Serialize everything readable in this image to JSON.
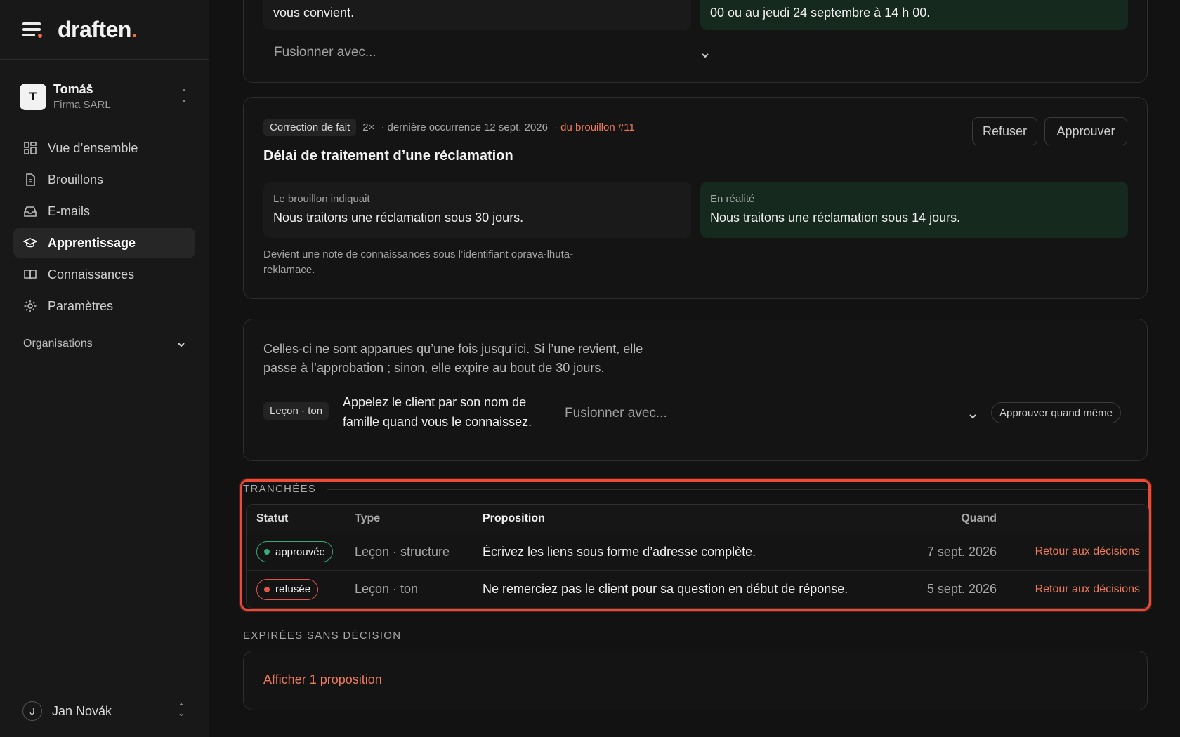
{
  "app": {
    "logo_text": "draften",
    "logo_dot": "."
  },
  "account": {
    "initial": "T",
    "name": "Tomáš",
    "company": "Firma SARL"
  },
  "nav": [
    {
      "label": "Vue d’ensemble",
      "icon": "grid-icon",
      "active": false
    },
    {
      "label": "Brouillons",
      "icon": "document-icon",
      "active": false
    },
    {
      "label": "E-mails",
      "icon": "inbox-icon",
      "active": false
    },
    {
      "label": "Apprentissage",
      "icon": "graduation-cap-icon",
      "active": true
    },
    {
      "label": "Connaissances",
      "icon": "book-icon",
      "active": false
    },
    {
      "label": "Paramètres",
      "icon": "gear-icon",
      "active": false
    }
  ],
  "organisations_label": "Organisations",
  "user": {
    "initial": "J",
    "name": "Jan Novák"
  },
  "card_top": {
    "left_text": "vous convient.",
    "right_text": "00 ou au jeudi 24 septembre à 14 h 00.",
    "merge_placeholder": "Fusionner avec..."
  },
  "card_fact": {
    "tag": "Correction de fait",
    "count": "2×",
    "last_seen": "· dernière occurrence 12 sept. 2026",
    "source": "· du brouillon #11",
    "refuse_label": "Refuser",
    "approve_label": "Approuver",
    "title": "Délai de traitement d’une réclamation",
    "left_label": "Le brouillon indiquait",
    "left_text": "Nous traitons une réclamation sous 30 jours.",
    "right_label": "En réalité",
    "right_text": "Nous traitons une réclamation sous 14 jours.",
    "note": "Devient une note de connaissances sous l’identifiant oprava-lhuta-reklamace."
  },
  "card_once": {
    "intro": "Celles-ci ne sont apparues qu’une fois jusqu’ici. Si l’une revient, elle passe à l’approbation ; sinon, elle expire au bout de 30 jours.",
    "tag": "Leçon · ton",
    "text": "Appelez le client par son nom de famille quand vous le connaissez.",
    "merge_placeholder": "Fusionner avec...",
    "approve_anyway": "Approuver quand même"
  },
  "decided": {
    "section": "TRANCHÉES",
    "headers": {
      "status": "Statut",
      "type": "Type",
      "proposal": "Proposition",
      "when": "Quand"
    },
    "rows": [
      {
        "status": "approuvée",
        "type": "Leçon · structure",
        "proposal": "Écrivez les liens sous forme d’adresse complète.",
        "when": "7 sept. 2026",
        "action": "Retour aux décisions"
      },
      {
        "status": "refusée",
        "type": "Leçon · ton",
        "proposal": "Ne remerciez pas le client pour sa question en début de réponse.",
        "when": "5 sept. 2026",
        "action": "Retour aux décisions"
      }
    ]
  },
  "expired": {
    "section": "EXPIRÉES SANS DÉCISION",
    "show_label": "Afficher 1 proposition"
  },
  "colors": {
    "accent": "#f06a4a",
    "approved": "#3ba876",
    "refused": "#e0584a",
    "highlight": "#ee4a36"
  }
}
